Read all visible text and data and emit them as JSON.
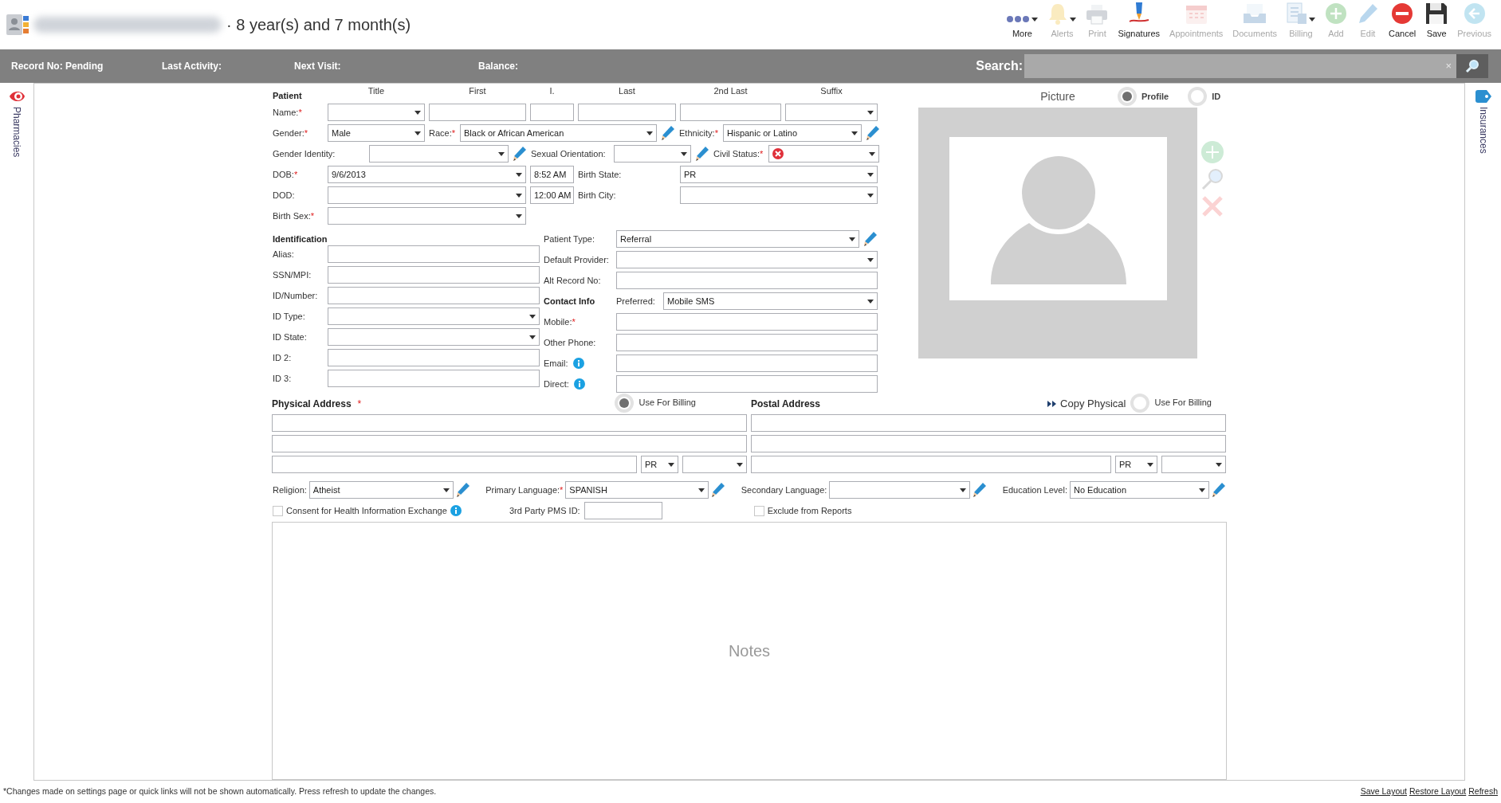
{
  "header": {
    "age": "· 8 year(s) and 7 month(s)"
  },
  "toolbar": [
    {
      "label": "More",
      "disabled": false,
      "dropdown": true
    },
    {
      "label": "Alerts",
      "disabled": true,
      "dropdown": true
    },
    {
      "label": "Print",
      "disabled": true,
      "dropdown": false
    },
    {
      "label": "Signatures",
      "disabled": false,
      "dropdown": false
    },
    {
      "label": "Appointments",
      "disabled": true,
      "dropdown": false
    },
    {
      "label": "Documents",
      "disabled": true,
      "dropdown": false
    },
    {
      "label": "Billing",
      "disabled": true,
      "dropdown": true
    },
    {
      "label": "Add",
      "disabled": true,
      "dropdown": false
    },
    {
      "label": "Edit",
      "disabled": true,
      "dropdown": false
    },
    {
      "label": "Cancel",
      "disabled": false,
      "dropdown": false
    },
    {
      "label": "Save",
      "disabled": false,
      "dropdown": false
    },
    {
      "label": "Previous",
      "disabled": true,
      "dropdown": false
    }
  ],
  "info_bar": {
    "items": [
      "Record No: Pending",
      "Last Activity:",
      "Next Visit:",
      "Balance:"
    ],
    "search": {
      "label": "Search:",
      "clear": "×"
    }
  },
  "side_tabs": {
    "left": "Pharmacies",
    "right": "Insurances"
  },
  "patient": {
    "heading": "Patient",
    "name_part_headers": [
      "Title",
      "First",
      "I.",
      "Last",
      "2nd Last",
      "Suffix"
    ],
    "lines": [
      [
        {
          "kind": "label",
          "text": "Name:",
          "mark": "*"
        },
        {
          "kind": "select"
        },
        {
          "kind": "input"
        },
        {
          "kind": "input"
        },
        {
          "kind": "input"
        },
        {
          "kind": "input"
        },
        {
          "kind": "select"
        }
      ],
      [
        {
          "kind": "label",
          "text": "Gender:",
          "mark": "*"
        },
        {
          "kind": "select",
          "value": "Male"
        },
        {
          "kind": "label",
          "text": "Race:",
          "mark": "*"
        },
        {
          "kind": "select",
          "value": "Black or African American",
          "editable": true
        },
        {
          "kind": "label",
          "text": "Ethnicity:",
          "mark": "*"
        },
        {
          "kind": "select",
          "value": "Hispanic or Latino",
          "editable": true
        }
      ],
      [
        {
          "kind": "label",
          "text": "Gender Identity:"
        },
        {
          "kind": "select",
          "editable": true
        },
        {
          "kind": "label",
          "text": "Sexual Orientation:"
        },
        {
          "kind": "select",
          "editable": true
        },
        {
          "kind": "label",
          "text": "Civil Status:",
          "mark": "*"
        },
        {
          "kind": "select",
          "error": true
        }
      ],
      [
        {
          "kind": "label",
          "text": "DOB:",
          "mark": "*"
        },
        {
          "kind": "select",
          "value": "9/6/2013"
        },
        {
          "kind": "input",
          "value": "8:52 AM"
        },
        {
          "kind": "label",
          "text": "Birth State:"
        },
        {
          "kind": "select",
          "value": "PR"
        }
      ],
      [
        {
          "kind": "label",
          "text": "DOD:"
        },
        {
          "kind": "select"
        },
        {
          "kind": "input",
          "value": "12:00 AM"
        },
        {
          "kind": "label",
          "text": "Birth City:"
        },
        {
          "kind": "select"
        }
      ],
      [
        {
          "kind": "label",
          "text": "Birth Sex:",
          "mark": "*"
        },
        {
          "kind": "select"
        }
      ]
    ]
  },
  "identification": {
    "heading": "Identification",
    "rows": [
      [
        {
          "kind": "label",
          "text": "Alias:"
        },
        {
          "kind": "input"
        }
      ],
      [
        {
          "kind": "label",
          "text": "SSN/MPI:"
        },
        {
          "kind": "input"
        }
      ],
      [
        {
          "kind": "label",
          "text": "ID/Number:"
        },
        {
          "kind": "input"
        }
      ],
      [
        {
          "kind": "label",
          "text": "ID Type:"
        },
        {
          "kind": "select"
        }
      ],
      [
        {
          "kind": "label",
          "text": "ID State:"
        },
        {
          "kind": "select"
        }
      ],
      [
        {
          "kind": "label",
          "text": "ID 2:"
        },
        {
          "kind": "input"
        }
      ],
      [
        {
          "kind": "label",
          "text": "ID 3:"
        },
        {
          "kind": "input"
        }
      ]
    ]
  },
  "contact": {
    "rows": [
      [
        {
          "kind": "label",
          "text": "Patient Type:"
        },
        {
          "kind": "select",
          "value": "Referral",
          "editable": true
        }
      ],
      [
        {
          "kind": "label",
          "text": "Default Provider:"
        },
        {
          "kind": "select"
        }
      ],
      [
        {
          "kind": "label",
          "text": "Alt Record No:"
        },
        {
          "kind": "input"
        }
      ],
      [
        {
          "kind": "heading",
          "text": "Contact Info"
        },
        {
          "kind": "label",
          "text": "Preferred:"
        },
        {
          "kind": "select",
          "value": "Mobile SMS"
        }
      ],
      [
        {
          "kind": "label",
          "text": "Mobile:",
          "mark": "*"
        },
        {
          "kind": "input"
        }
      ],
      [
        {
          "kind": "label",
          "text": "Other Phone:"
        },
        {
          "kind": "input"
        }
      ],
      [
        {
          "kind": "label",
          "text": "Email:",
          "info": true
        },
        {
          "kind": "input"
        }
      ],
      [
        {
          "kind": "label",
          "text": "Direct:",
          "info": true
        },
        {
          "kind": "input"
        }
      ]
    ]
  },
  "picture": {
    "title": "Picture",
    "options": [
      {
        "label": "Profile",
        "selected": true
      },
      {
        "label": "ID",
        "selected": false
      }
    ]
  },
  "address": {
    "physical": {
      "heading": "Physical Address",
      "mark": "*",
      "billing": {
        "label": "Use For Billing",
        "selected": true
      },
      "rows": [
        [
          {
            "kind": "input"
          }
        ],
        [
          {
            "kind": "input"
          }
        ],
        [
          {
            "kind": "input"
          },
          {
            "kind": "select",
            "value": "PR"
          },
          {
            "kind": "select"
          }
        ]
      ]
    },
    "postal": {
      "heading": "Postal Address",
      "copy": "Copy Physical",
      "billing": {
        "label": "Use For Billing",
        "selected": false
      },
      "rows": [
        [
          {
            "kind": "input"
          }
        ],
        [
          {
            "kind": "input"
          }
        ],
        [
          {
            "kind": "input"
          },
          {
            "kind": "select",
            "value": "PR"
          },
          {
            "kind": "select"
          }
        ]
      ]
    }
  },
  "demographics": [
    [
      {
        "kind": "label",
        "text": "Religion:"
      },
      {
        "kind": "select",
        "value": "Atheist",
        "editable": true
      }
    ],
    [
      {
        "kind": "label",
        "text": "Primary Language:",
        "mark": "*"
      },
      {
        "kind": "select",
        "value": "SPANISH",
        "editable": true
      }
    ],
    [
      {
        "kind": "label",
        "text": "Secondary Language:"
      },
      {
        "kind": "select",
        "editable": true
      }
    ],
    [
      {
        "kind": "label",
        "text": "Education Level:"
      },
      {
        "kind": "select",
        "value": "No Education",
        "editable": true
      }
    ]
  ],
  "options": [
    {
      "kind": "checkbox",
      "label": "Consent for Health Information Exchange",
      "checked": false,
      "info": true
    },
    {
      "kind": "label",
      "text": "3rd Party PMS ID:"
    },
    {
      "kind": "input"
    },
    {
      "kind": "checkbox",
      "label": "Exclude from Reports",
      "checked": false
    }
  ],
  "notes": {
    "placeholder": "Notes"
  },
  "footer": {
    "note": "*Changes made on settings page or quick links will not be shown automatically. Press refresh to update the changes.",
    "links": [
      "Save Layout",
      "Restore Layout",
      "Refresh"
    ]
  }
}
